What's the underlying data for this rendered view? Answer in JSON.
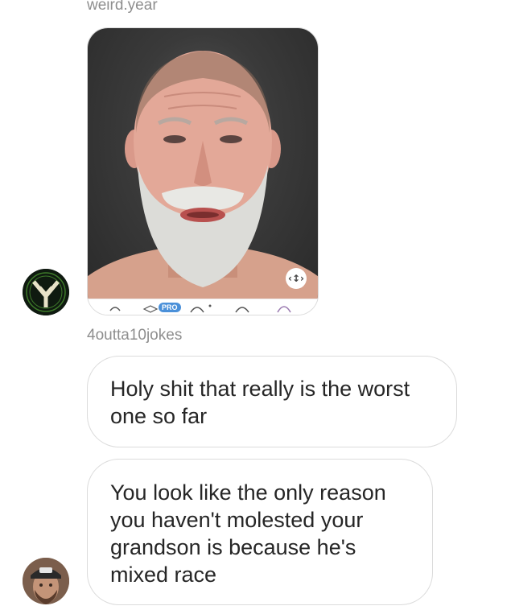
{
  "messages": [
    {
      "sender": "weird.year",
      "type": "photo",
      "photo_alt": "selfie of bearded man",
      "filter_badge": "PRO"
    },
    {
      "sender": "4outta10jokes",
      "type": "text",
      "lines": [
        "Holy shit that really is the worst",
        "one so far"
      ]
    },
    {
      "type": "text",
      "lines": [
        "You look like the only reason",
        "you haven't molested your",
        "grandson is because he's",
        "mixed race"
      ]
    }
  ],
  "colors": {
    "bubble_border": "#dbdbdb",
    "sender_text": "#8e8e8e",
    "message_text": "#262626",
    "pro_badge": "#4a90d9"
  },
  "icons": {
    "expand": "expand-arrows-icon",
    "avatar_top": "weird-year-avatar",
    "avatar_bottom": "4outta10jokes-avatar"
  }
}
